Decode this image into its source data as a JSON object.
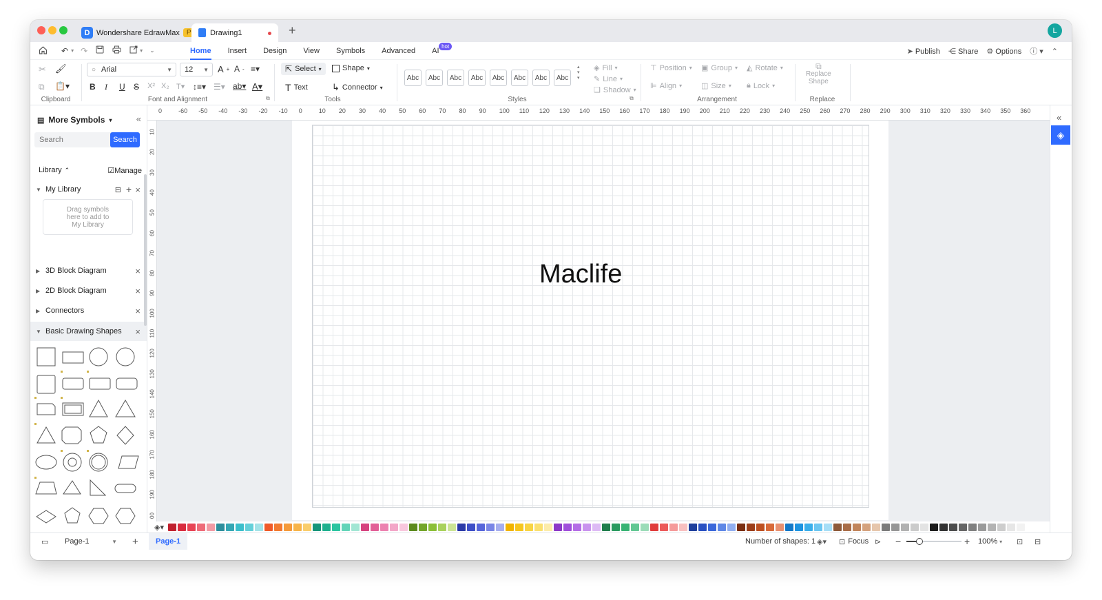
{
  "tabs": [
    {
      "label": "Wondershare EdrawMax",
      "badge": "Pro"
    },
    {
      "label": "Drawing1"
    }
  ],
  "user_initial": "L",
  "menus": [
    {
      "label": "Home"
    },
    {
      "label": "Insert"
    },
    {
      "label": "Design"
    },
    {
      "label": "View"
    },
    {
      "label": "Symbols"
    },
    {
      "label": "Advanced"
    },
    {
      "label": "AI",
      "badge": "hot"
    }
  ],
  "right_menu": {
    "publish": "Publish",
    "share": "Share",
    "options": "Options"
  },
  "ribbon": {
    "font_family": "Arial",
    "font_size": "12",
    "select": "Select",
    "shape": "Shape",
    "text": "Text",
    "connector": "Connector",
    "style_sample": "Abc",
    "fill": "Fill",
    "line": "Line",
    "shadow": "Shadow",
    "position": "Position",
    "group": "Group",
    "rotate": "Rotate",
    "align": "Align",
    "size": "Size",
    "lock": "Lock",
    "replace_shape_1": "Replace",
    "replace_shape_2": "Shape",
    "group_labels": {
      "clipboard": "Clipboard",
      "font": "Font and Alignment",
      "tools": "Tools",
      "styles": "Styles",
      "arrangement": "Arrangement",
      "replace": "Replace"
    }
  },
  "sidebar": {
    "title": "More Symbols",
    "search_placeholder": "Search",
    "search_button": "Search",
    "library": "Library",
    "manage": "Manage",
    "my_library": "My Library",
    "drag_hint_1": "Drag symbols",
    "drag_hint_2": "here to add to",
    "drag_hint_3": "My Library",
    "libraries": [
      "3D Block Diagram",
      "2D Block Diagram",
      "Connectors",
      "Basic Drawing Shapes"
    ]
  },
  "ruler": {
    "h_ticks": [
      "0",
      "-60",
      "-50",
      "-40",
      "-30",
      "-20",
      "-10",
      "0",
      "10",
      "20",
      "30",
      "40",
      "50",
      "60",
      "70",
      "80",
      "90",
      "100",
      "110",
      "120",
      "130",
      "140",
      "150",
      "160",
      "170",
      "180",
      "190",
      "200",
      "210",
      "220",
      "230",
      "240",
      "250",
      "260",
      "270",
      "280",
      "290",
      "300",
      "310",
      "320",
      "330",
      "340",
      "350",
      "360"
    ],
    "v_ticks": [
      "10",
      "20",
      "30",
      "40",
      "50",
      "60",
      "70",
      "80",
      "90",
      "100",
      "110",
      "120",
      "130",
      "140",
      "150",
      "160",
      "170",
      "180",
      "190",
      "00"
    ]
  },
  "canvas_text": "Maclife",
  "palette_colors": [
    "#c0202e",
    "#d92c3f",
    "#e84455",
    "#ee6b79",
    "#f29aa4",
    "#2e8f9d",
    "#35a7b4",
    "#3cbfcb",
    "#65d0d9",
    "#a3e3e8",
    "#ef5a28",
    "#f27a30",
    "#f59a3a",
    "#f7b44a",
    "#f9cd6c",
    "#15957a",
    "#1eb08e",
    "#2ac4a0",
    "#62d4b8",
    "#a2e6d4",
    "#d6427e",
    "#e25f97",
    "#ec82b0",
    "#f3a6c8",
    "#f8c7dd",
    "#5c8a1e",
    "#73a52a",
    "#8bbf38",
    "#a8d15c",
    "#cbe494",
    "#2b3aa8",
    "#3d4ec7",
    "#5665da",
    "#7a86e6",
    "#a6aeef",
    "#f2b400",
    "#f6c61f",
    "#f8d444",
    "#fae070",
    "#fcecaa",
    "#8c38c8",
    "#a04fdb",
    "#b46de6",
    "#c993ee",
    "#ddbaf5",
    "#1f7d4c",
    "#2a9a60",
    "#38b374",
    "#62c793",
    "#9bdcb8",
    "#e03b3b",
    "#ec5a5a",
    "#f59a9a",
    "#f8c0c0",
    "#1e3f9c",
    "#2951c2",
    "#3a67da",
    "#5e87e6",
    "#91aef0",
    "#7a2e12",
    "#9c3e1a",
    "#bd5022",
    "#d86a3a",
    "#e89070",
    "#1479c8",
    "#1d93e0",
    "#3aaeea",
    "#6cc6f1",
    "#a6def7",
    "#8e5a3a",
    "#a86d48",
    "#c1855c",
    "#d4a27e",
    "#e6c6ac",
    "#7b7b7b",
    "#969696",
    "#b1b1b1",
    "#cbcbcb",
    "#e3e3e3",
    "#1c1c1c",
    "#333333",
    "#4d4d4d",
    "#666666",
    "#808080",
    "#9a9a9a",
    "#b3b3b3",
    "#cdcdcd",
    "#e6e6e6",
    "#f2f2f2"
  ],
  "statusbar": {
    "page_select": "Page-1",
    "page_tab": "Page-1",
    "shape_count": "Number of shapes: 1",
    "focus": "Focus",
    "zoom": "100%"
  }
}
